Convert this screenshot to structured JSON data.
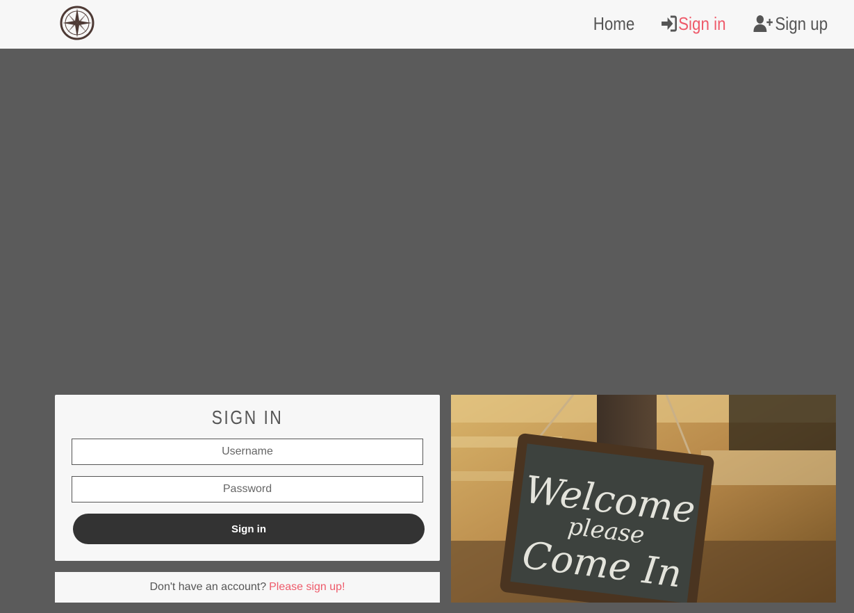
{
  "nav": {
    "home": "Home",
    "signin": "Sign in",
    "signup": "Sign up"
  },
  "form": {
    "title": "SIGN IN",
    "username_placeholder": "Username",
    "password_placeholder": "Password",
    "submit_label": "Sign in"
  },
  "signup_prompt": {
    "text": "Don't have an account?",
    "link": "Please sign up!"
  },
  "image": {
    "sign_line1": "Welcome",
    "sign_line2": "please",
    "sign_line3": "Come In"
  },
  "colors": {
    "accent": "#ee5a6a",
    "nav_bg": "#f7f7f7",
    "page_bg": "#5b5b5b",
    "button_bg": "#333333"
  },
  "icons": {
    "logo": "compass-logo",
    "signin": "sign-in-arrow-icon",
    "signup": "user-plus-icon"
  }
}
